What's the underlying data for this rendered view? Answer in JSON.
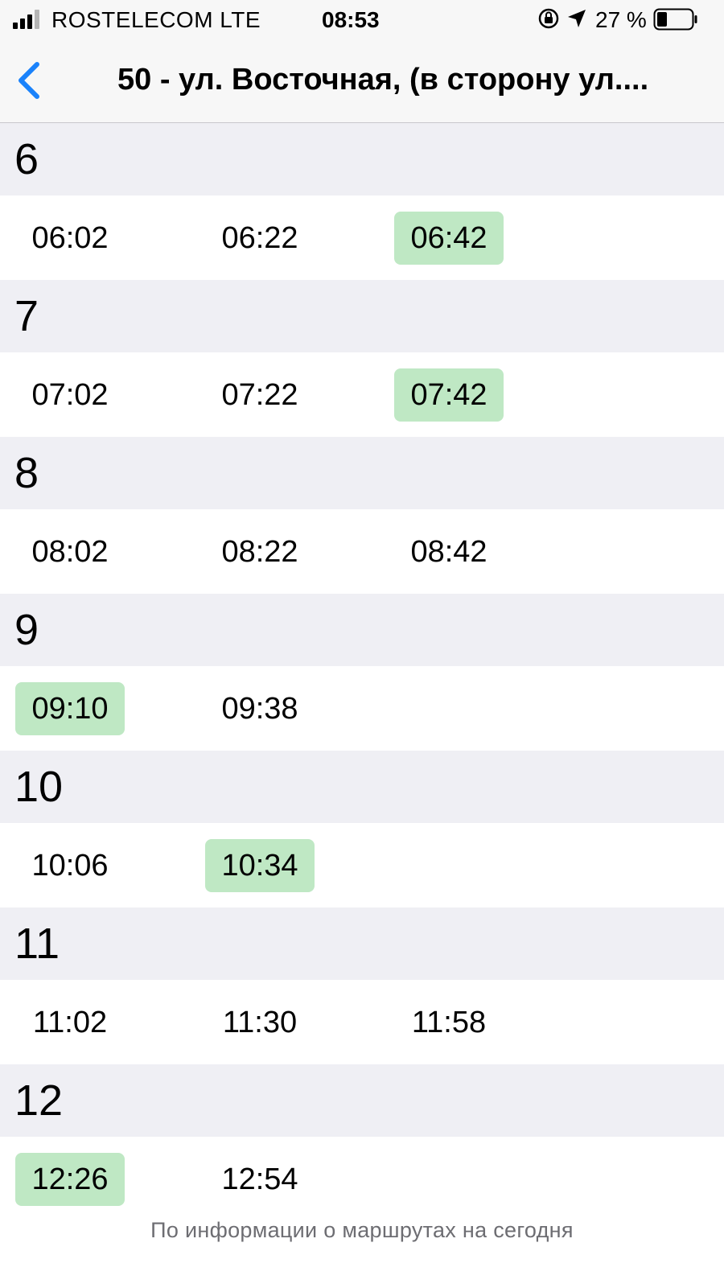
{
  "status_bar": {
    "carrier": "ROSTELECOM  LTE",
    "time": "08:53",
    "battery": "27 %"
  },
  "nav": {
    "back_icon": "chevron-left-icon",
    "title": "50 - ул. Восточная, (в сторону ул....",
    "accent": "#1a82fb"
  },
  "highlight_color": "#bfe8c4",
  "schedule": [
    {
      "hour": "6",
      "times": [
        {
          "t": "06:02",
          "hl": false
        },
        {
          "t": "06:22",
          "hl": false
        },
        {
          "t": "06:42",
          "hl": true
        }
      ]
    },
    {
      "hour": "7",
      "times": [
        {
          "t": "07:02",
          "hl": false
        },
        {
          "t": "07:22",
          "hl": false
        },
        {
          "t": "07:42",
          "hl": true
        }
      ]
    },
    {
      "hour": "8",
      "times": [
        {
          "t": "08:02",
          "hl": false
        },
        {
          "t": "08:22",
          "hl": false
        },
        {
          "t": "08:42",
          "hl": false
        }
      ]
    },
    {
      "hour": "9",
      "times": [
        {
          "t": "09:10",
          "hl": true
        },
        {
          "t": "09:38",
          "hl": false
        }
      ]
    },
    {
      "hour": "10",
      "times": [
        {
          "t": "10:06",
          "hl": false
        },
        {
          "t": "10:34",
          "hl": true
        }
      ]
    },
    {
      "hour": "11",
      "times": [
        {
          "t": "11:02",
          "hl": false
        },
        {
          "t": "11:30",
          "hl": false
        },
        {
          "t": "11:58",
          "hl": false
        }
      ]
    },
    {
      "hour": "12",
      "times": [
        {
          "t": "12:26",
          "hl": true
        },
        {
          "t": "12:54",
          "hl": false
        }
      ]
    }
  ],
  "footer": "По информации о маршрутах на сегодня"
}
